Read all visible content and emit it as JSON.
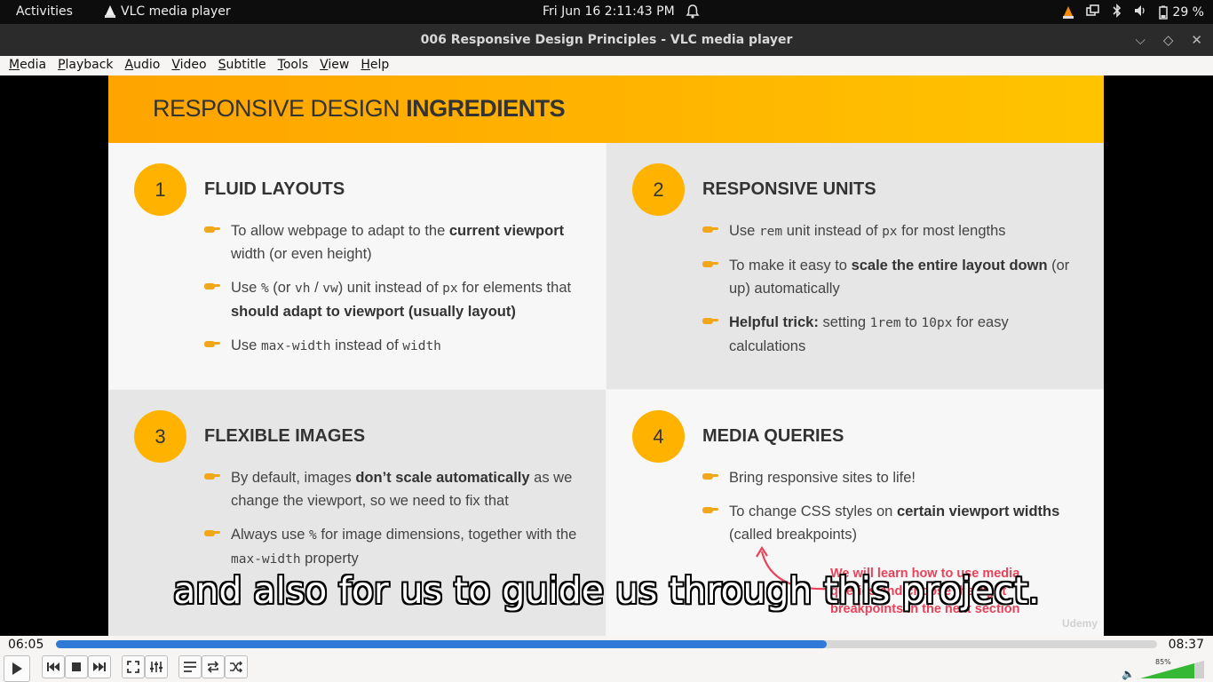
{
  "topbar": {
    "activities": "Activities",
    "app_name": "VLC media player",
    "clock": "Fri Jun 16   2:11:43 PM",
    "battery": "29 %"
  },
  "window": {
    "title": "006 Responsive Design Principles - VLC media player"
  },
  "menu": [
    "Media",
    "Playback",
    "Audio",
    "Video",
    "Subtitle",
    "Tools",
    "View",
    "Help"
  ],
  "slide": {
    "header_light": "RESPONSIVE DESIGN ",
    "header_bold": "INGREDIENTS",
    "q1": {
      "num": "1",
      "title": "FLUID LAYOUTS",
      "b1_a": "To allow webpage to adapt to the ",
      "b1_b": "current viewport",
      "b1_c": " width (or even height)",
      "b2_a": "Use ",
      "b2_code1": "%",
      "b2_b": " (or ",
      "b2_code2": "vh",
      "b2_c": " / ",
      "b2_code3": "vw",
      "b2_d": ") unit instead of ",
      "b2_code4": "px",
      "b2_e": " for elements that ",
      "b2_f": "should adapt to viewport (usually layout)",
      "b3_a": "Use ",
      "b3_code1": "max-width",
      "b3_b": " instead of ",
      "b3_code2": "width"
    },
    "q2": {
      "num": "2",
      "title": "RESPONSIVE UNITS",
      "b1_a": "Use ",
      "b1_code1": "rem",
      "b1_b": " unit instead of ",
      "b1_code2": "px",
      "b1_c": " for most lengths",
      "b2_a": "To make it easy to ",
      "b2_b": "scale the entire layout down",
      "b2_c": " (or up) automatically",
      "b3_a": "Helpful trick:",
      "b3_b": " setting ",
      "b3_code1": "1rem",
      "b3_c": " to ",
      "b3_code2": "10px",
      "b3_d": " for easy calculations"
    },
    "q3": {
      "num": "3",
      "title": "FLEXIBLE IMAGES",
      "b1_a": "By default, images ",
      "b1_b": "don’t scale automatically",
      "b1_c": " as we change the viewport, so we need to fix that",
      "b2_a": "Always use ",
      "b2_code1": "%",
      "b2_b": " for image dimensions, together with the ",
      "b2_code2": "max-width",
      "b2_c": " property"
    },
    "q4": {
      "num": "4",
      "title": "MEDIA QUERIES",
      "b1": "Bring responsive sites to life!",
      "b2_a": "To change CSS styles on ",
      "b2_b": "certain viewport widths",
      "b2_c": " (called breakpoints)"
    },
    "note_line1": "We will learn how to use media",
    "note_line2": "queries and choose the right",
    "note_line3": "breakpoints in the next section",
    "watermark": "Udemy"
  },
  "subtitle": "and also for us to guide us through this project.",
  "player": {
    "elapsed": "06:05",
    "total": "08:37",
    "progress_fraction": 0.7,
    "volume": "85%",
    "volume_fraction": 0.85
  }
}
